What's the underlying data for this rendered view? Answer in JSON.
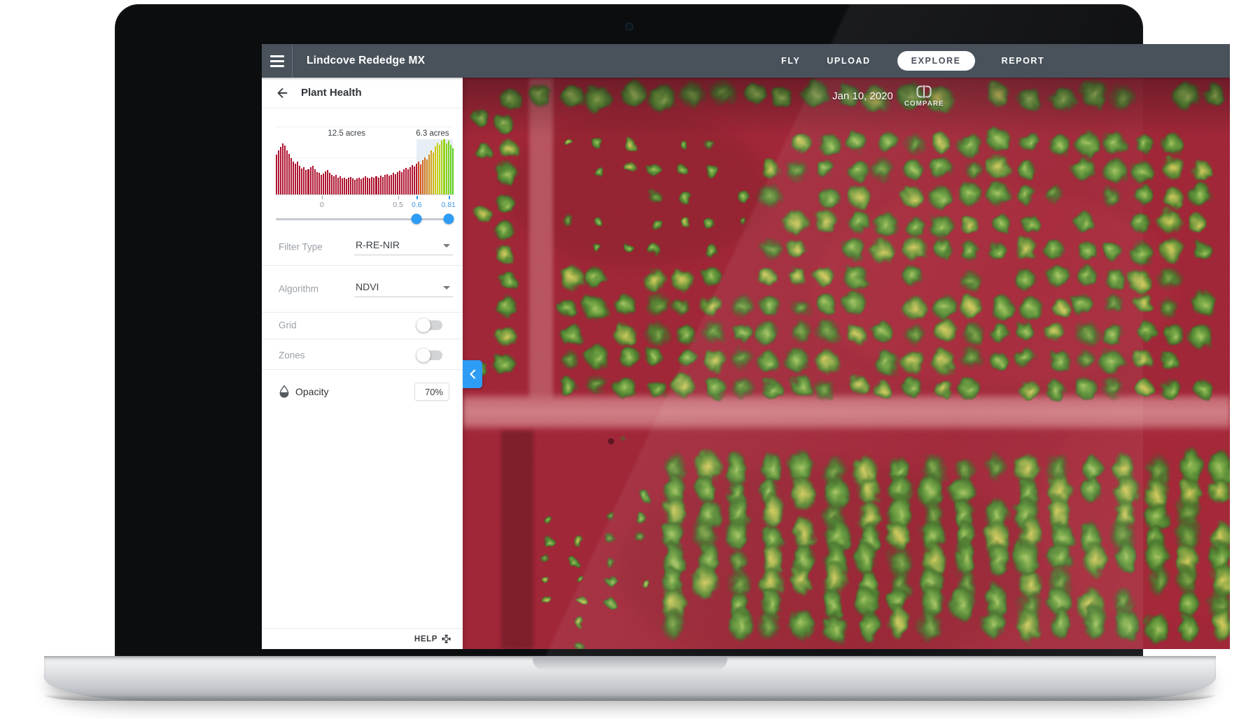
{
  "navbar": {
    "title": "Lindcove Rededge MX",
    "items": [
      {
        "label": "FLY",
        "active": false
      },
      {
        "label": "UPLOAD",
        "active": false
      },
      {
        "label": "EXPLORE",
        "active": true
      },
      {
        "label": "REPORT",
        "active": false
      }
    ]
  },
  "sidebar": {
    "title": "Plant Health",
    "histogram": {
      "type": "histogram",
      "left_area": {
        "label": "12.5 acres",
        "frac": 0.4
      },
      "right_area": {
        "label": "6.3 acres",
        "frac": 0.885
      },
      "x_ticks": [
        {
          "label": "0",
          "frac": 0.26,
          "highlight": false
        },
        {
          "label": "0.5",
          "frac": 0.69,
          "highlight": false
        },
        {
          "label": "0.6",
          "frac": 0.795,
          "highlight": true
        },
        {
          "label": "0.81",
          "frac": 0.975,
          "highlight": true
        }
      ],
      "selection": {
        "min": 0.6,
        "max": 0.81,
        "min_frac": 0.795,
        "max_frac": 0.975,
        "zone_end_frac": 1.0
      },
      "bar_color": "#ae1430",
      "selection_bg": "#e8eef6",
      "handle_color": "#2d9cf4",
      "bars": [
        0.72,
        0.8,
        0.86,
        0.92,
        0.88,
        0.8,
        0.74,
        0.66,
        0.6,
        0.56,
        0.6,
        0.52,
        0.47,
        0.5,
        0.44,
        0.46,
        0.49,
        0.52,
        0.46,
        0.41,
        0.39,
        0.36,
        0.38,
        0.42,
        0.44,
        0.39,
        0.36,
        0.33,
        0.35,
        0.31,
        0.33,
        0.29,
        0.31,
        0.28,
        0.3,
        0.32,
        0.29,
        0.27,
        0.29,
        0.31,
        0.28,
        0.3,
        0.33,
        0.31,
        0.29,
        0.32,
        0.3,
        0.33,
        0.31,
        0.34,
        0.32,
        0.35,
        0.37,
        0.34,
        0.36,
        0.39,
        0.37,
        0.41,
        0.43,
        0.4,
        0.45,
        0.48,
        0.45,
        0.49,
        0.53,
        0.51,
        0.56,
        0.59,
        0.55,
        0.62,
        0.67,
        0.63,
        0.72,
        0.8,
        0.76,
        0.87,
        0.94,
        0.9,
        0.97,
        1.0,
        0.93,
        0.97,
        0.9,
        0.84
      ]
    },
    "filter_type": {
      "label": "Filter Type",
      "value": "R-RE-NIR"
    },
    "algorithm": {
      "label": "Algorithm",
      "value": "NDVI"
    },
    "toggles": [
      {
        "label": "Grid",
        "on": false
      },
      {
        "label": "Zones",
        "on": false
      }
    ],
    "opacity": {
      "label": "Opacity",
      "value": "70%"
    },
    "help_label": "HELP"
  },
  "map": {
    "date_label": "Jan 10, 2020",
    "compare_label": "COMPARE",
    "base_color": "#a02134"
  }
}
